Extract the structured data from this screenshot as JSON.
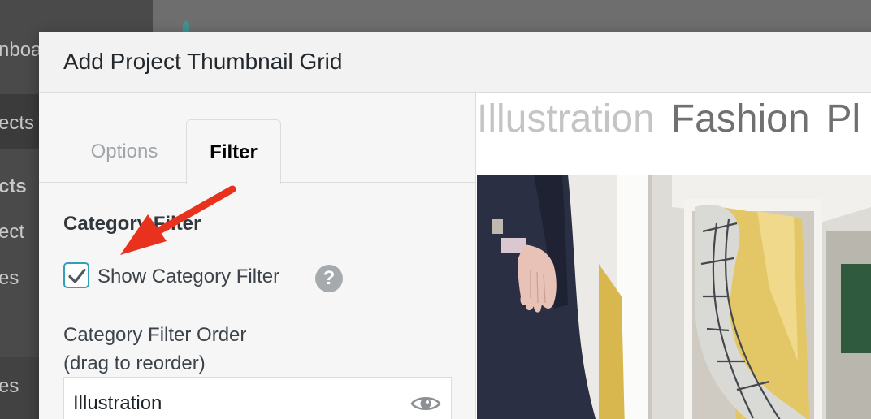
{
  "background": {
    "sidebar_items": [
      "nboa",
      "ects",
      "cts",
      "ect",
      "es",
      "es"
    ]
  },
  "modal": {
    "title": "Add Project Thumbnail Grid",
    "tabs": [
      {
        "label": "Options",
        "active": false
      },
      {
        "label": "Filter",
        "active": true
      }
    ]
  },
  "filter_panel": {
    "section_title": "Category Filter",
    "show_filter": {
      "label": "Show Category Filter",
      "checked": true,
      "help_glyph": "?"
    },
    "order_label_line1": "Category Filter Order",
    "order_label_line2": "(drag to reorder)",
    "order_items": [
      {
        "label": "Illustration",
        "icon": "eye-icon"
      }
    ]
  },
  "preview": {
    "filters": [
      "Illustration",
      "Fashion",
      "Pl"
    ]
  },
  "colors": {
    "checkbox_border": "#33a0b8",
    "arrow": "#e8321e",
    "help_icon": "#a7aaad"
  }
}
